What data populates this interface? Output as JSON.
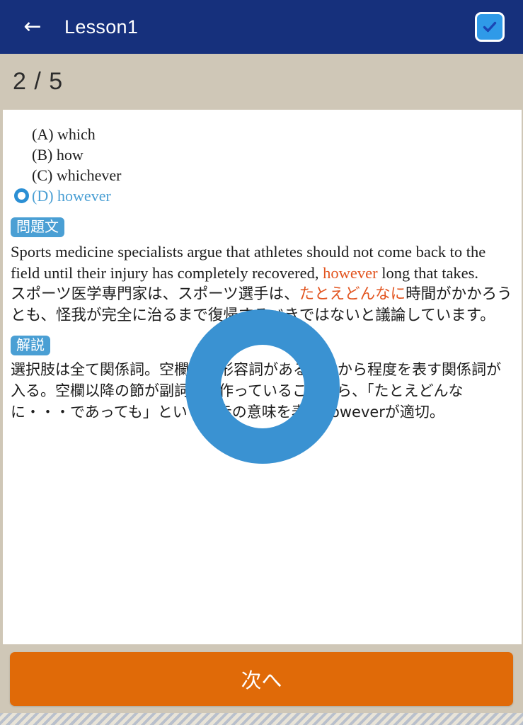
{
  "appbar": {
    "back_icon": "back-arrow-icon",
    "title": "Lesson1",
    "check_icon": "checkbox-checked-icon"
  },
  "progress": {
    "counter": "2 / 5",
    "current": 2,
    "total": 5
  },
  "choices": [
    {
      "marker": "",
      "label": "(A) which",
      "selected": false
    },
    {
      "marker": "",
      "label": "(B) how",
      "selected": false
    },
    {
      "marker": "",
      "label": "(C) whichever",
      "selected": false
    },
    {
      "marker": "ring-icon",
      "label": "(D) however",
      "selected": true
    }
  ],
  "question_section": {
    "badge": "問題文",
    "english_before": "Sports medicine specialists argue that athletes should not come back to the field until their injury has completely recovered, ",
    "english_highlight": "however",
    "english_after": " long that takes.",
    "japanese_before": "スポーツ医学専門家は、スポーツ選手は、",
    "japanese_highlight": "たとえどんなに",
    "japanese_after": "時間がかかろうとも、怪我が完全に治るまで復帰するべきではないと議論しています。"
  },
  "explanation_section": {
    "badge": "解説",
    "text": "選択肢は全て関係詞。空欄後に形容詞があることから程度を表す関係詞が入る。空欄以降の節が副詞節を作っていることから、「たとえどんなに・・・であっても」という譲歩の意味を表すhoweverが適切。"
  },
  "loading": {
    "spinner": "loading-spinner-ring",
    "color": "#3a92d2"
  },
  "footer": {
    "next_label": "次へ"
  },
  "colors": {
    "appbar": "#16307c",
    "band": "#cfc7b7",
    "accent_blue": "#4a9fd4",
    "highlight_orange": "#e2541f",
    "button_orange": "#e06a08"
  }
}
